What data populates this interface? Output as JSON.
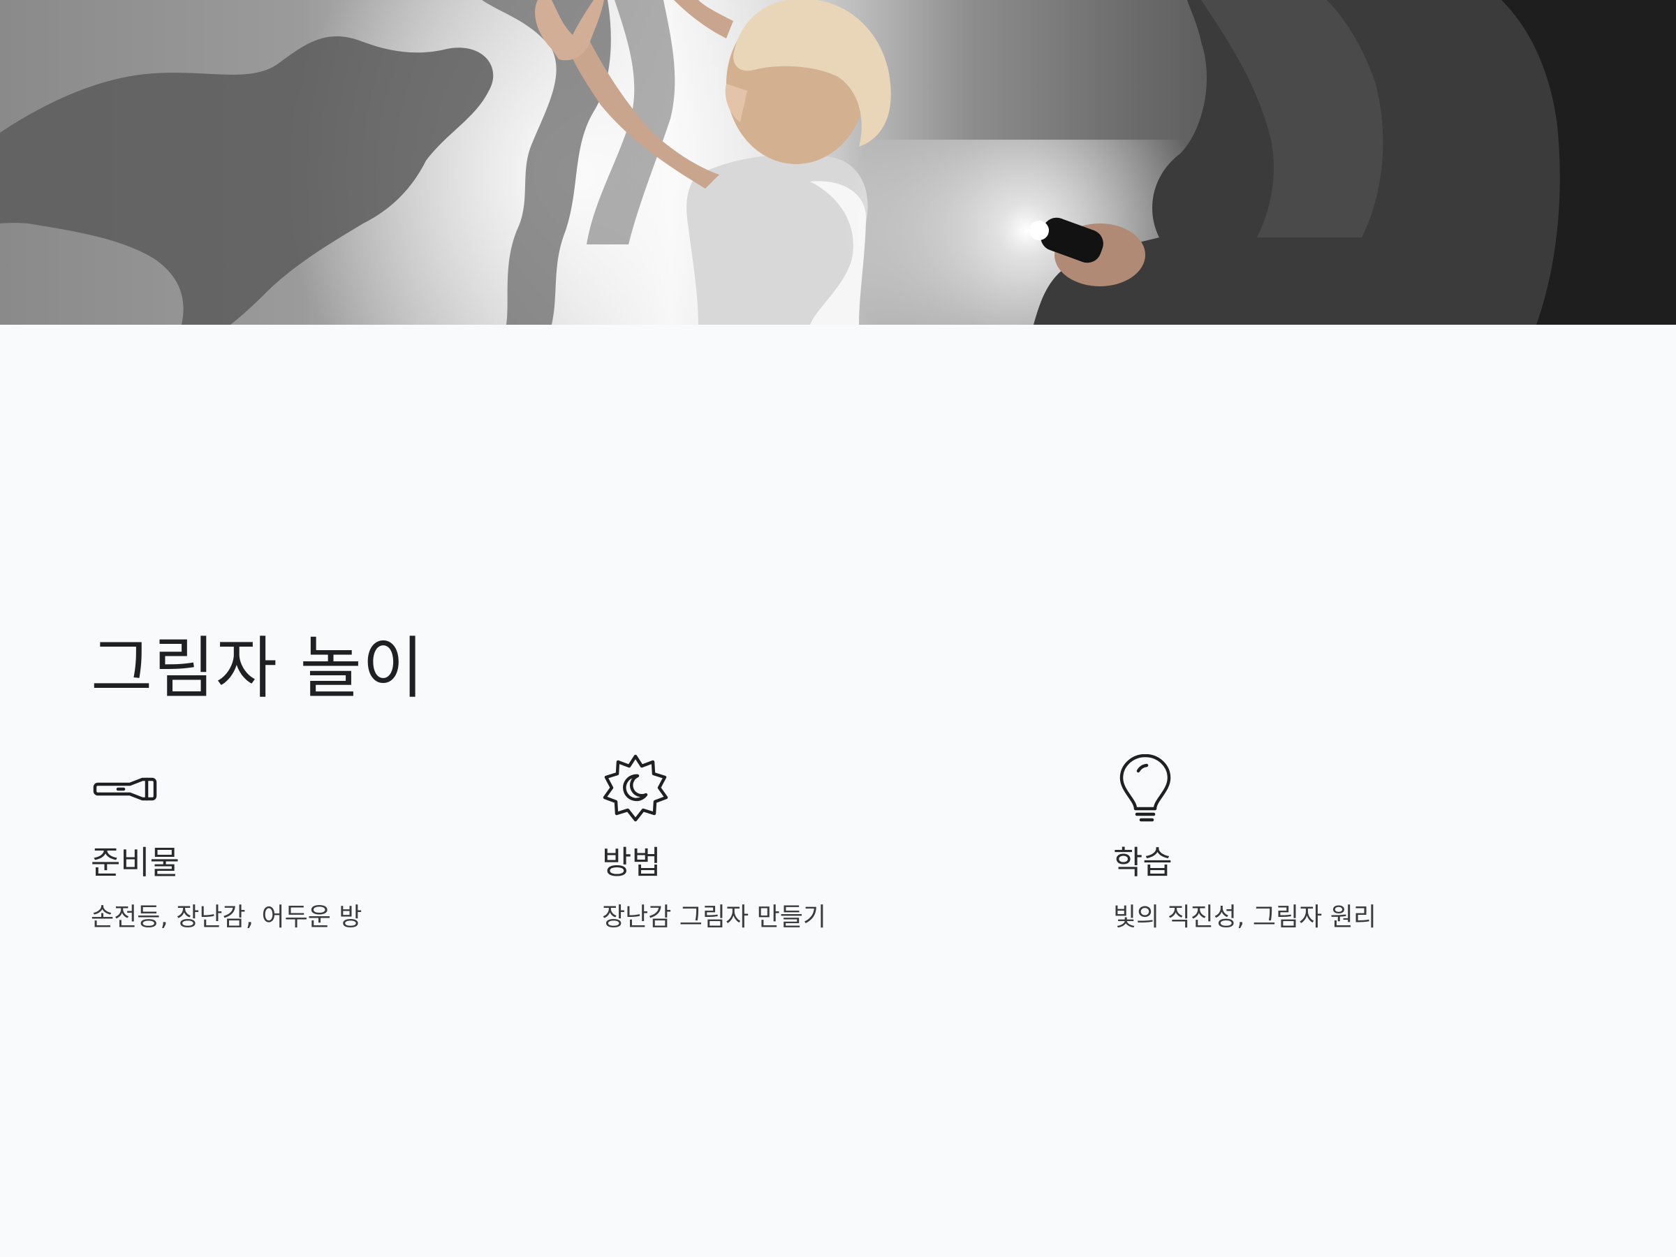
{
  "hero": {
    "image": "child-shadow-play-photo"
  },
  "page": {
    "title": "그림자 놀이"
  },
  "features": [
    {
      "icon": "flashlight-icon",
      "title": "준비물",
      "description": "손전등, 장난감, 어두운 방"
    },
    {
      "icon": "moon-badge-icon",
      "title": "방법",
      "description": "장난감 그림자 만들기"
    },
    {
      "icon": "lightbulb-icon",
      "title": "학습",
      "description": "빛의 직진성, 그림자 원리"
    }
  ],
  "colors": {
    "background": "#f9fafb",
    "text": "#1f2023",
    "icon": "#1f2023"
  }
}
